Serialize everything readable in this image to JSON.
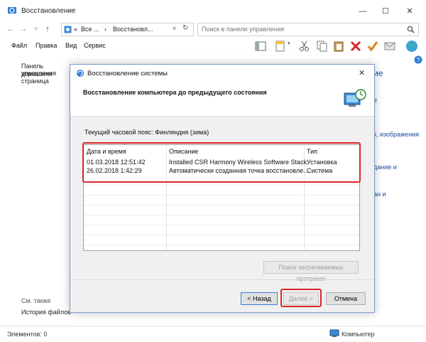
{
  "window": {
    "title": "Восстановление",
    "minimize": "—",
    "maximize": "☐",
    "close": "✕"
  },
  "address": {
    "prefix": "«",
    "crumb1": "Все ...",
    "sep": "›",
    "crumb2": "Восстановл...",
    "search_placeholder": "Поиск в панели управления"
  },
  "menu": {
    "file": "Файл",
    "edit": "Правка",
    "view": "Вид",
    "service": "Сервис"
  },
  "left_panel": {
    "line1": "Панель управления",
    "line2": "домашняя страница",
    "see_also": "См. также",
    "file_history": "История файлов"
  },
  "right_fragments": {
    "a": "ие",
    "b": "е",
    "c": "к, изображения",
    "d": "дание и",
    "e": "ан и"
  },
  "statusbar": {
    "items": "Элементов: 0",
    "computer": "Компьютер"
  },
  "dialog": {
    "title": "Восстановление системы",
    "close": "✕",
    "header": "Восстановление компьютера до предыдущего состояния",
    "timezone": "Текущий часовой пояс: Финляндия (зима)",
    "columns": {
      "date": "Дата и время",
      "desc": "Описание",
      "type": "Тип"
    },
    "rows": [
      {
        "date": "01.03.2018 12:51:42",
        "desc": "Installed CSR Harmony Wireless Software Stack.",
        "type": "Установка"
      },
      {
        "date": "26.02.2018 1:42:29",
        "desc": "Автоматически созданная точка восстановле...",
        "type": "Система"
      }
    ],
    "affected_programs": "Поиск затрагиваемых программ",
    "back": "< Назад",
    "next": "Далее >",
    "cancel": "Отмена"
  },
  "colors": {
    "accent": "#1a4c9a",
    "highlight": "#d9262a"
  }
}
